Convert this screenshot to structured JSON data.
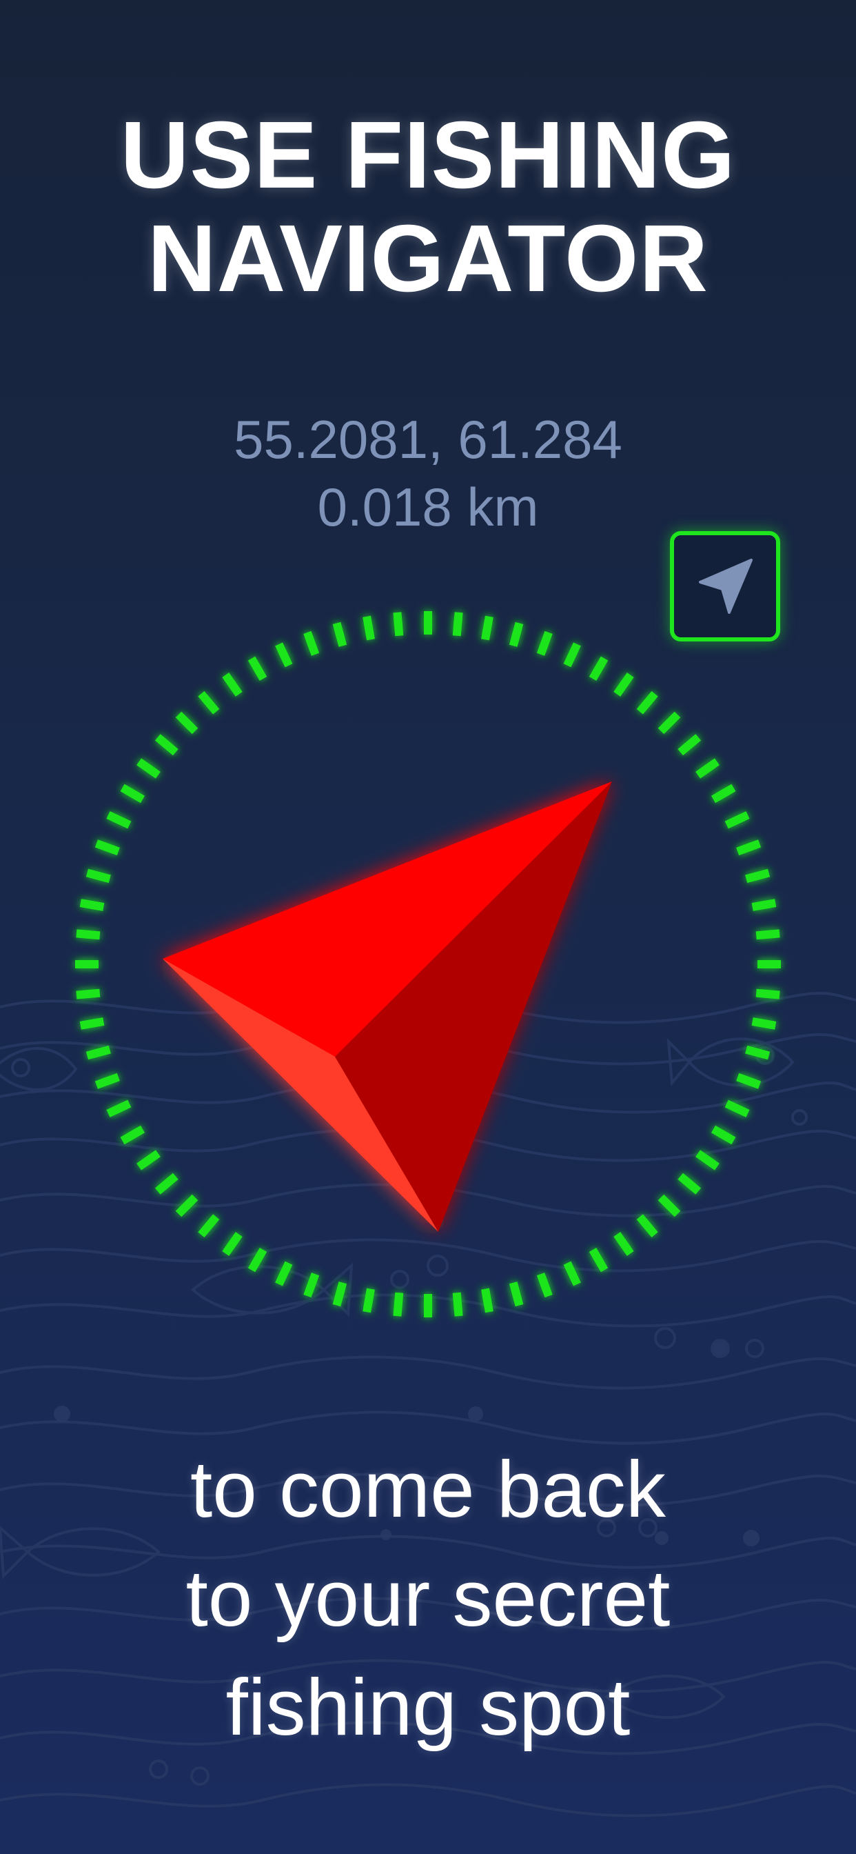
{
  "headline": {
    "line1": "USE FISHING",
    "line2": "NAVIGATOR"
  },
  "location": {
    "coordinates": "55.2081, 61.284",
    "distance": "0.018 km"
  },
  "nav_button": {
    "icon": "location-arrow-icon"
  },
  "compass": {
    "ring_color": "#1ee51e",
    "arrow_color": "#ff0000",
    "icon": "direction-arrow-icon"
  },
  "tagline": {
    "line1": "to come back",
    "line2": "to your secret",
    "line3": "fishing spot"
  },
  "colors": {
    "background": "#172339",
    "accent_green": "#1ee51e",
    "accent_red": "#ff0000",
    "muted_text": "#7f93b9"
  }
}
